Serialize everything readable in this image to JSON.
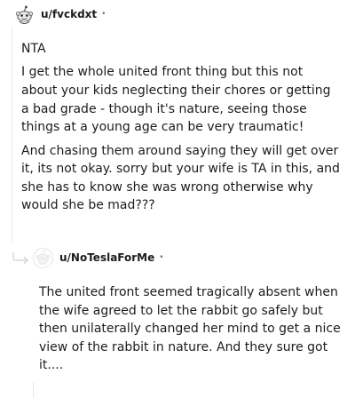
{
  "comment": {
    "username": "u/fvckdxt",
    "separator": "•",
    "avatar_icon": "snoo-avatar-icon",
    "paragraphs": [
      "NTA",
      "I get the whole united front thing but this not about your kids neglecting their chores or getting a bad grade - though it's nature, seeing those things at a young age can be very traumatic!",
      "And chasing them around saying they will get over it, its not okay. sorry but your wife is TA in this, and she has to know she was wrong otherwise why would she be mad???"
    ]
  },
  "reply": {
    "username": "u/NoTeslaForMe",
    "separator": "•",
    "avatar_icon": "default-avatar-icon",
    "paragraphs": [
      "The united front seemed tragically absent when the wife agreed to let the rabbit go safely but then unilaterally changed her mind to get a nice view of the rabbit in nature. And they sure got it...."
    ]
  }
}
